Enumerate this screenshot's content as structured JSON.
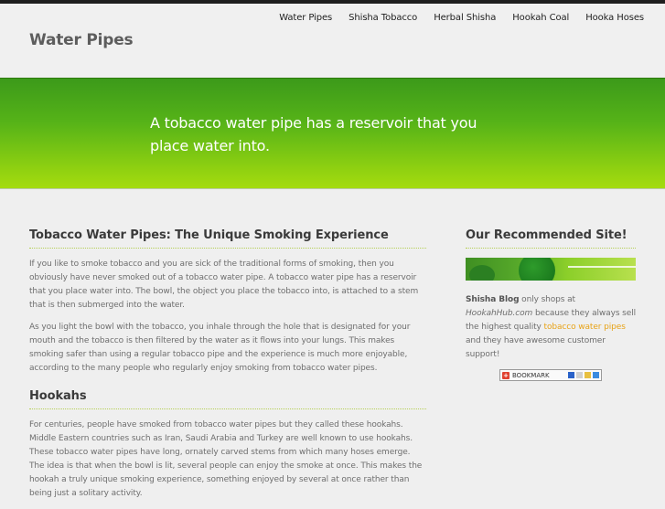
{
  "header": {
    "site_title": "Water Pipes",
    "nav": [
      "Water Pipes",
      "Shisha Tobacco",
      "Herbal Shisha",
      "Hookah Coal",
      "Hooka Hoses"
    ]
  },
  "hero": {
    "text": "A tobacco water pipe has a reservoir that you place water into."
  },
  "main": {
    "section1_title": "Tobacco Water Pipes: The Unique Smoking Experience",
    "section1_p1": "If you like to smoke tobacco and you are sick of the traditional forms of smoking, then you obviously have never smoked out of a tobacco water pipe. A tobacco water pipe has a reservoir that you place water into. The bowl, the object you place the tobacco into, is attached to a stem that is then submerged into the water.",
    "section1_p2": "As you light the bowl with the tobacco, you inhale through the hole that is designated for your mouth and the tobacco is then filtered by the water as it flows into your lungs. This makes smoking safer than using a regular tobacco pipe and the experience is much more enjoyable, according to the many people who regularly enjoy smoking from tobacco water pipes.",
    "section2_title": "Hookahs",
    "section2_p1": "For centuries, people have smoked from tobacco water pipes but they called these hookahs. Middle Eastern countries such as Iran, Saudi Arabia and Turkey are well known to use hookahs. These tobacco water pipes have long, ornately carved stems from which many hoses emerge. The idea is that when the bowl is lit, several people can enjoy the smoke at once. This makes the hookah a truly unique smoking experience, something enjoyed by several at once rather than being just a solitary activity."
  },
  "sidebar": {
    "title": "Our Recommended Site!",
    "blog_name": "Shisha Blog",
    "text_a": " only shops at ",
    "site_url": "HookahHub.com",
    "text_b": " because they always sell the highest quality ",
    "link_text": "tobacco water pipes",
    "text_c": " and they have awesome customer support!",
    "bookmark_label": "BOOKMARK",
    "bookmark_plus": "+"
  },
  "colors": {
    "hero_green": "#56b318",
    "link_orange": "#e8a317",
    "divider": "#b5cf54"
  }
}
